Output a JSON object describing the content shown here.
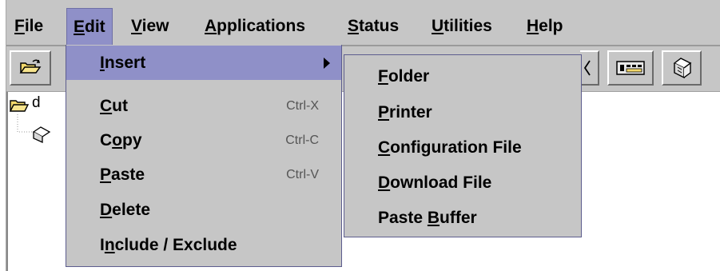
{
  "menubar": {
    "items": [
      {
        "label": "File",
        "mnemonic": "F"
      },
      {
        "label": "Edit",
        "mnemonic": "E"
      },
      {
        "label": "View",
        "mnemonic": "V"
      },
      {
        "label": "Applications",
        "mnemonic": "A"
      },
      {
        "label": "Status",
        "mnemonic": "S"
      },
      {
        "label": "Utilities",
        "mnemonic": "U"
      },
      {
        "label": "Help",
        "mnemonic": "H"
      }
    ],
    "active": "Edit"
  },
  "edit_menu": {
    "items": [
      {
        "label": "Insert",
        "has_submenu": true,
        "shortcut": ""
      },
      {
        "label": "Cut",
        "shortcut": "Ctrl-X"
      },
      {
        "label": "Copy",
        "shortcut": "Ctrl-C"
      },
      {
        "label": "Paste",
        "shortcut": "Ctrl-V"
      },
      {
        "label": "Delete",
        "shortcut": ""
      },
      {
        "label": "Include / Exclude",
        "shortcut": ""
      }
    ],
    "highlighted": "Insert"
  },
  "insert_submenu": {
    "items": [
      {
        "label": "Folder"
      },
      {
        "label": "Printer"
      },
      {
        "label": "Configuration File"
      },
      {
        "label": "Download File"
      },
      {
        "label": "Paste Buffer"
      }
    ]
  },
  "tree": {
    "root_label_partial": "d"
  },
  "icons": {
    "open_folder": "open-folder-icon",
    "printer_card": "printer-card-icon",
    "document_stack": "document-stack-icon",
    "tree_folder": "folder-icon",
    "tree_printer": "printer-icon"
  },
  "colors": {
    "menu_highlight": "#8f90c8",
    "background": "#c6c6c6",
    "tree_background": "#ffffff"
  }
}
